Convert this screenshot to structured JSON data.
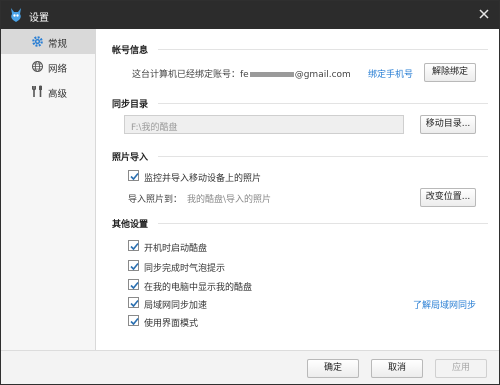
{
  "window": {
    "title": "设置",
    "accent_color": "#2c2c2c",
    "close_icon": "close-icon"
  },
  "sidebar": {
    "items": [
      {
        "label": "常规",
        "icon": "gear-icon",
        "active": true
      },
      {
        "label": "网络",
        "icon": "globe-icon",
        "active": false
      },
      {
        "label": "高级",
        "icon": "tools-icon",
        "active": false
      }
    ]
  },
  "account": {
    "section_title": "帐号信息",
    "bound_text_prefix": "这台计算机已经绑定账号：fe",
    "bound_text_suffix": "@gmail.com",
    "bind_phone_link": "绑定手机号",
    "unbind_button": "解除绑定"
  },
  "sync_dir": {
    "section_title": "同步目录",
    "path_value": "F:\\我的酷盘",
    "move_button": "移动目录..."
  },
  "photo_import": {
    "section_title": "照片导入",
    "monitor_checkbox_label": "监控并导入移动设备上的照片",
    "monitor_checked": true,
    "import_to_label": "导入照片到：",
    "import_to_value": "我的酷盘\\导入的照片",
    "change_location_button": "改变位置..."
  },
  "other": {
    "section_title": "其他设置",
    "options": [
      {
        "label": "开机时启动酷盘",
        "checked": true
      },
      {
        "label": "同步完成时气泡提示",
        "checked": true
      },
      {
        "label": "在我的电脑中显示我的酷盘",
        "checked": true
      },
      {
        "label": "局域网同步加速",
        "checked": true
      },
      {
        "label": "使用界面模式",
        "checked": true
      }
    ],
    "lan_sync_link": "了解局域网同步"
  },
  "footer": {
    "ok_button": "确定",
    "cancel_button": "取消",
    "apply_button": "应用",
    "apply_disabled": true
  },
  "colors": {
    "link": "#2a7fd4",
    "sidebar_bg": "#f6f6f6",
    "sidebar_active": "#d9d9d9"
  }
}
